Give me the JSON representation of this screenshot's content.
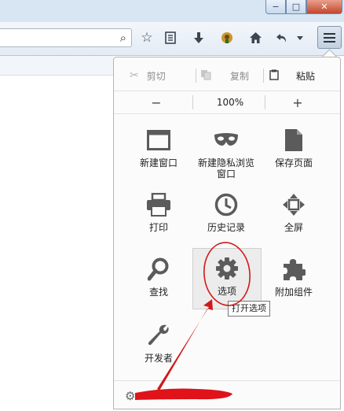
{
  "edit": {
    "cut": "剪切",
    "copy": "复制",
    "paste": "粘贴"
  },
  "zoom": {
    "minus": "−",
    "level": "100%",
    "plus": "+"
  },
  "tiles": {
    "new_window": "新建窗口",
    "private_line1": "新建隐私浏览",
    "private_line2": "窗口",
    "save_page": "保存页面",
    "print": "打印",
    "history": "历史记录",
    "fullscreen": "全屏",
    "find": "查找",
    "options": "选项",
    "addons": "附加组件",
    "developer": "开发者"
  },
  "tooltip": "打开选项",
  "window": {
    "minimize": "−",
    "maximize": "□",
    "close": "✕"
  },
  "colors": {
    "annotation_red": "#d01818",
    "icon_gray": "#5b5b5b"
  },
  "icons": [
    "search-icon",
    "star-icon",
    "reading-list-icon",
    "download-icon",
    "home-icon",
    "back-icon",
    "dropdown-icon",
    "menu-icon"
  ]
}
